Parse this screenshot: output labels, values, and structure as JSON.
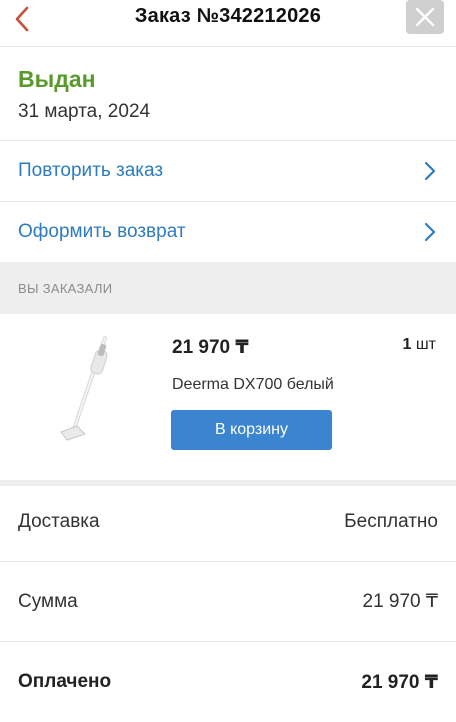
{
  "header": {
    "title": "Заказ №342212026"
  },
  "order": {
    "status": "Выдан",
    "date": "31 марта, 2024"
  },
  "actions": [
    {
      "label": "Повторить заказ"
    },
    {
      "label": "Оформить возврат"
    }
  ],
  "ordered_section": {
    "title": "ВЫ ЗАКАЗАЛИ",
    "item": {
      "price": "21 970 ₸",
      "quantity_number": "1",
      "quantity_unit": "шт",
      "name": "Deerma DX700 белый",
      "cart_button": "В корзину"
    }
  },
  "summary": {
    "delivery_label": "Доставка",
    "delivery_value": "Бесплатно",
    "sum_label": "Сумма",
    "sum_value": "21 970 ₸",
    "paid_label": "Оплачено",
    "paid_value": "21 970 ₸"
  },
  "colors": {
    "accent": "#2d7cc1",
    "status_green": "#5a9a2c",
    "button_blue": "#3b84d0",
    "back_arrow_red": "#c8503a"
  },
  "icons": {
    "back": "chevron-left-icon",
    "close": "close-icon",
    "row_arrow": "chevron-right-icon"
  }
}
